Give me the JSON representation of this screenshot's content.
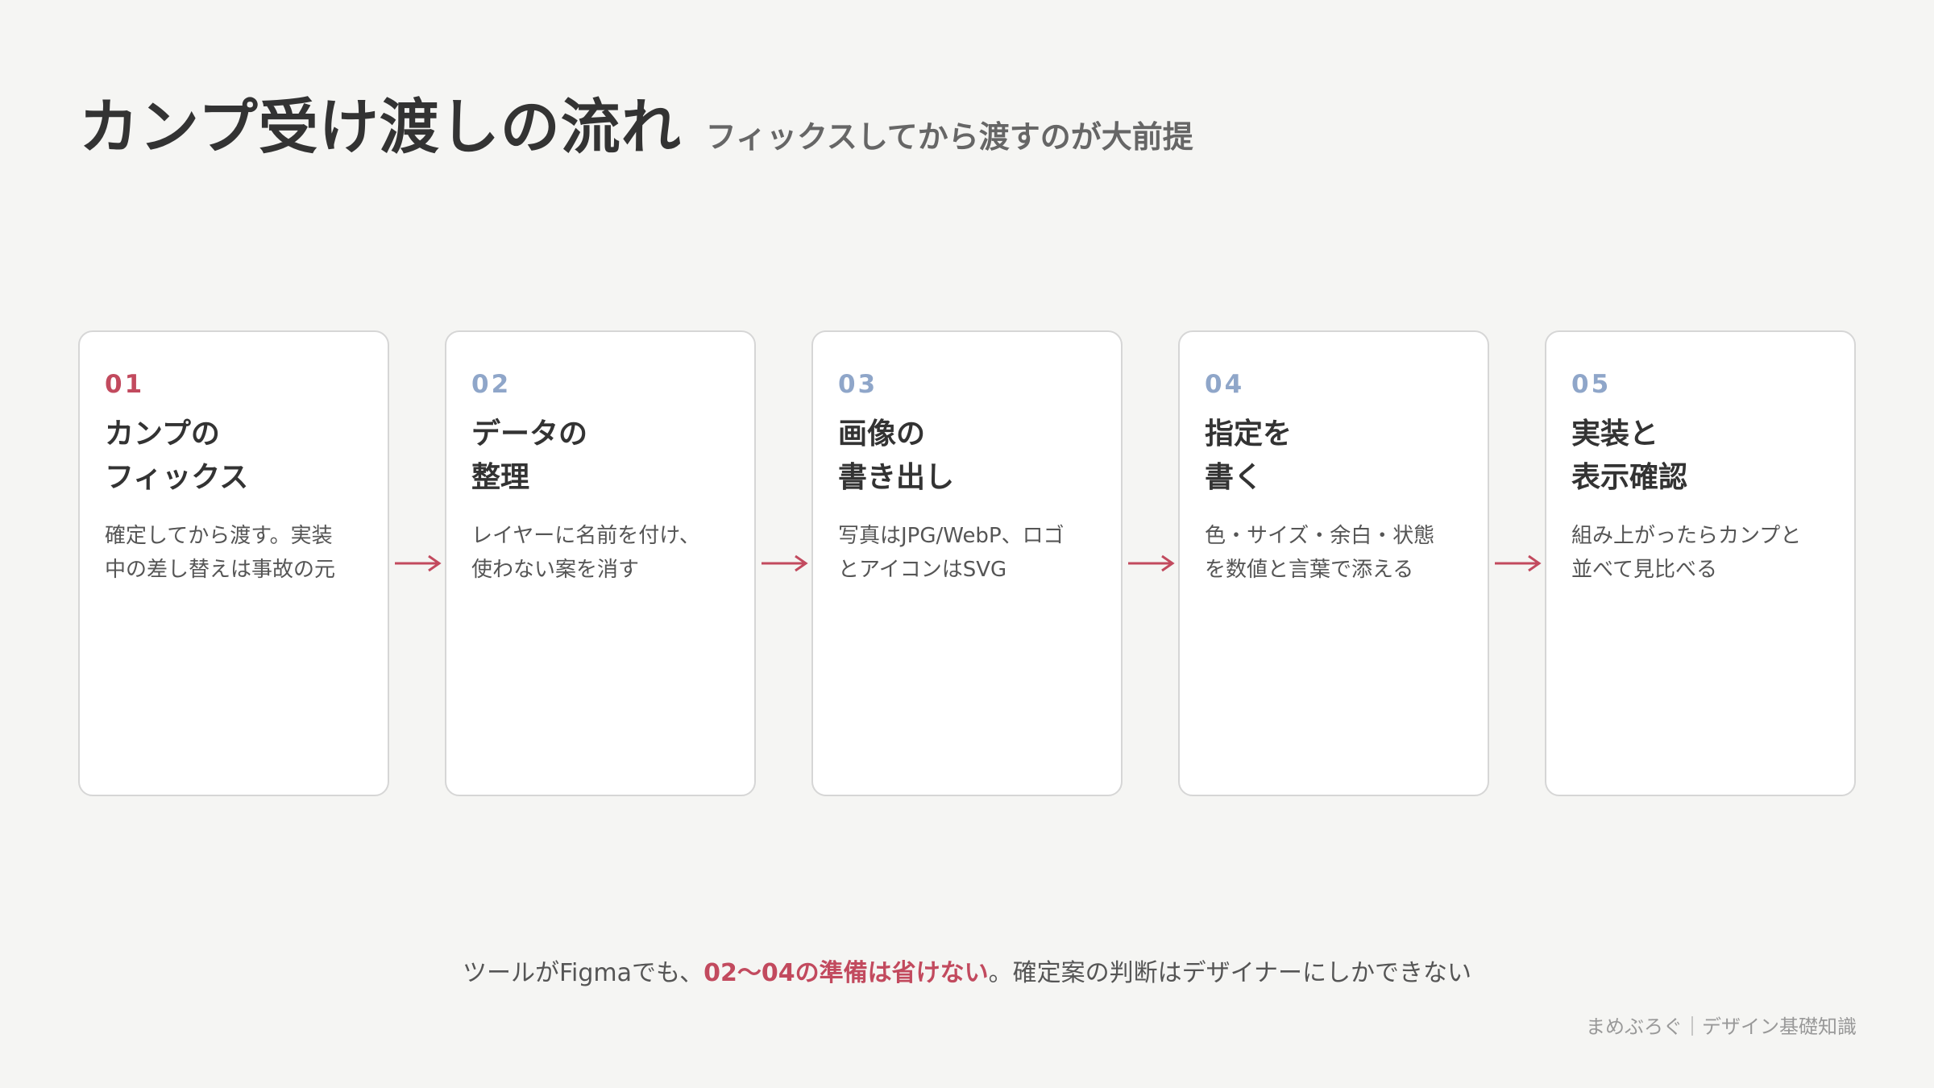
{
  "title": "カンプ受け渡しの流れ",
  "subtitle": "フィックスしてから渡すのが大前提",
  "colors": {
    "accent": "#c24a5e",
    "muted_number": "#8fa6c9",
    "background": "#f5f5f3"
  },
  "steps": [
    {
      "number": "01",
      "title_line1": "カンプの",
      "title_line2": "フィックス",
      "desc_line1": "確定してから渡す。実装",
      "desc_line2": "中の差し替えは事故の元"
    },
    {
      "number": "02",
      "title_line1": "データの",
      "title_line2": "整理",
      "desc_line1": "レイヤーに名前を付け、",
      "desc_line2": "使わない案を消す"
    },
    {
      "number": "03",
      "title_line1": "画像の",
      "title_line2": "書き出し",
      "desc_line1": "写真はJPG/WebP、ロゴ",
      "desc_line2": "とアイコンはSVG"
    },
    {
      "number": "04",
      "title_line1": "指定を",
      "title_line2": "書く",
      "desc_line1": "色・サイズ・余白・状態",
      "desc_line2": "を数値と言葉で添える"
    },
    {
      "number": "05",
      "title_line1": "実装と",
      "title_line2": "表示確認",
      "desc_line1": "組み上がったらカンプと",
      "desc_line2": "並べて見比べる"
    }
  ],
  "arrow_icon": "right-arrow",
  "note": {
    "prefix": "ツールがFigmaでも、",
    "highlight": "02〜04の準備は省けない",
    "suffix": "。確定案の判断はデザイナーにしかできない"
  },
  "footer": "まめぶろぐ｜デザイン基礎知識"
}
